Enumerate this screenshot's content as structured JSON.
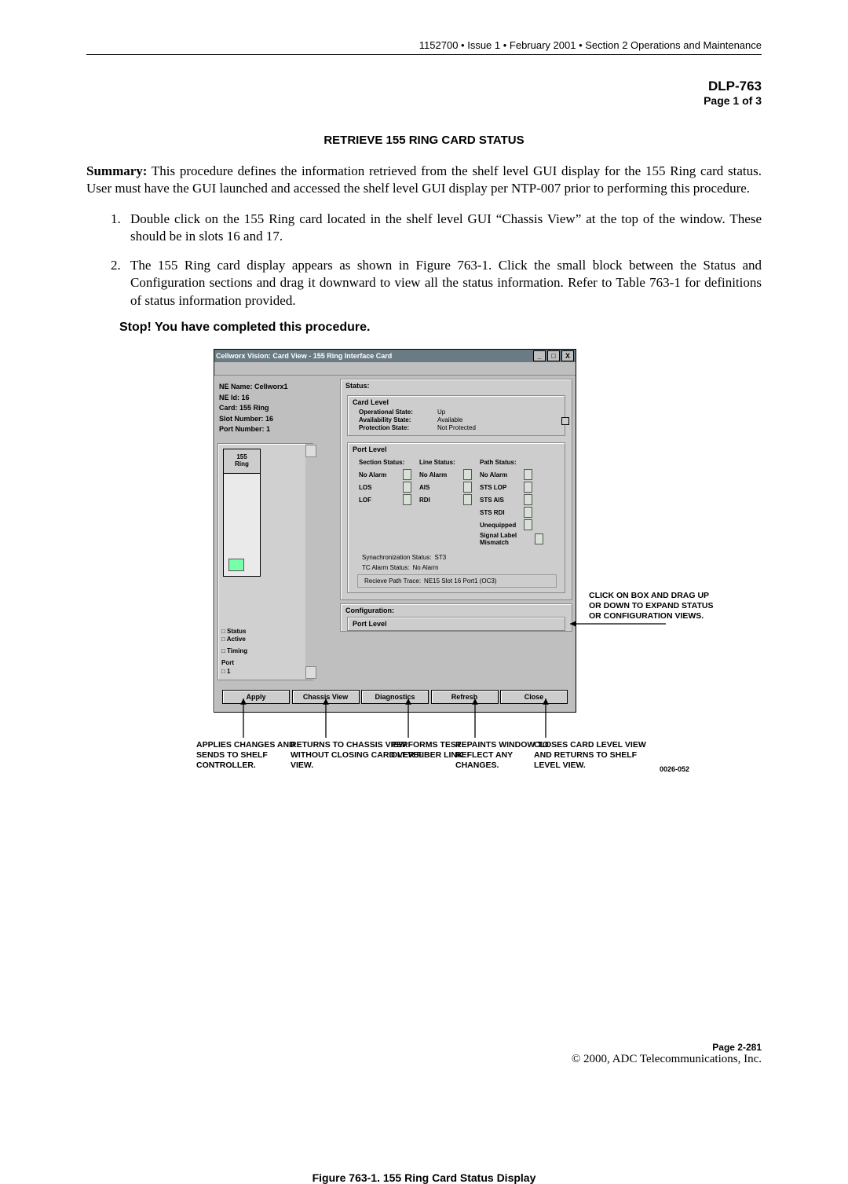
{
  "header_line": "1152700 • Issue 1 • February 2001 • Section 2 Operations and Maintenance",
  "dlp": "DLP-763",
  "page_of": "Page 1 of 3",
  "title": "RETRIEVE 155 RING CARD STATUS",
  "summary_label": "Summary:",
  "summary_text": " This procedure defines the information retrieved from the shelf level GUI display for the 155 Ring card status. User must have the GUI launched and accessed the shelf level GUI display per NTP-007 prior to performing this procedure.",
  "steps": [
    "Double click on the 155 Ring card located in the shelf level GUI “Chassis View” at the top of the window. These should be in slots 16 and 17.",
    "The 155 Ring card display appears as shown in Figure 763-1. Click the small block between the Status and Configuration sections and drag it downward to view all the status information. Refer to Table 763-1 for definitions of status information provided."
  ],
  "stop": "Stop! You have completed this procedure.",
  "gui": {
    "title": "Cellworx Vision:   Card View -   155 Ring Interface Card",
    "win_min": "_",
    "win_max": "□",
    "win_close": "X",
    "info_labels": {
      "ne_name_k": "NE Name:",
      "ne_name_v": "Cellworx1",
      "ne_id_k": "NE Id:",
      "ne_id_v": "16",
      "card_k": "Card:",
      "card_v": "155 Ring",
      "slot_k": "Slot Number:",
      "slot_v": "16",
      "port_k": "Port Number:",
      "port_v": "1"
    },
    "slot_label": "155\nRing",
    "legend": {
      "status": "□ Status",
      "active": "□ Active",
      "timing": "□ Timing",
      "port": "Port",
      "port1": "□ 1"
    },
    "status_title": "Status:",
    "card_level_title": "Card Level",
    "card_level": {
      "op_k": "Operational State:",
      "op_v": "Up",
      "av_k": "Availability State:",
      "av_v": "Available",
      "pr_k": "Protection State:",
      "pr_v": "Not Protected"
    },
    "port_level_title": "Port Level",
    "port_cols": {
      "section": {
        "hdr": "Section Status:",
        "items": [
          "No Alarm",
          "LOS",
          "LOF"
        ]
      },
      "line": {
        "hdr": "Line Status:",
        "items": [
          "No Alarm",
          "AIS",
          "RDI"
        ]
      },
      "path": {
        "hdr": "Path Status:",
        "items": [
          "No Alarm",
          "STS LOP",
          "STS AIS",
          "STS RDI",
          "Unequipped",
          "Signal Label Mismatch"
        ]
      }
    },
    "sync_k": "Synachronization Status:",
    "sync_v": "ST3",
    "tc_k": "TC Alarm Status:",
    "tc_v": "No Alarm",
    "rpt_k": "Recieve Path Trace:",
    "rpt_v": "NE15 Slot 16 Port1 (OC3)",
    "config_title": "Configuration:",
    "config_port_title": "Port Level",
    "buttons": {
      "apply": "Apply",
      "chassis": "Chassis View",
      "diag": "Diagnostics",
      "refresh": "Refresh",
      "close": "Close"
    }
  },
  "callouts": {
    "drag": "CLICK ON BOX AND DRAG UP OR DOWN TO EXPAND STATUS OR CONFIGURATION VIEWS.",
    "apply": "APPLIES CHANGES AND SENDS TO SHELF CONTROLLER.",
    "chassis": "RETURNS TO CHASSIS VIEW WITHOUT CLOSING CARD LEVEL VIEW.",
    "diag": "PERFORMS TEST OVER FIBER LINK.",
    "refresh": "REPAINTS WINDOW TO REFLECT ANY CHANGES.",
    "close": "CLOSES CARD LEVEL VIEW AND RETURNS TO SHELF LEVEL VIEW.",
    "figno": "0026-052"
  },
  "figure_caption": "Figure 763-1. 155 Ring Card Status Display",
  "footer_page": "Page 2-281",
  "footer_copy": "© 2000, ADC Telecommunications, Inc."
}
